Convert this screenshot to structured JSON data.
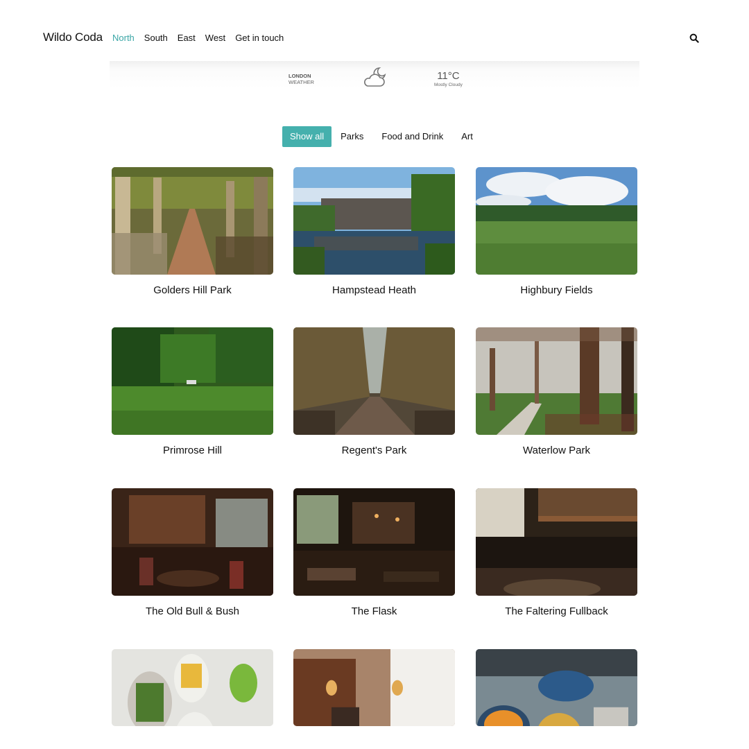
{
  "brand": "Wildo Coda",
  "nav": [
    "North",
    "South",
    "East",
    "West",
    "Get in touch"
  ],
  "nav_active": "North",
  "weather": {
    "city": "LONDON",
    "label": "WEATHER",
    "temp": "11°C",
    "condition": "Mostly Cloudy",
    "icon": "cloud-moon-icon"
  },
  "filters": [
    "Show all",
    "Parks",
    "Food and Drink",
    "Art"
  ],
  "filter_active": "Show all",
  "colors": {
    "accent": "#45b0ad",
    "nav_active": "#3aa6a6"
  },
  "places": [
    "Golders Hill Park",
    "Hampstead Heath",
    "Highbury Fields",
    "Primrose Hill",
    "Regent's Park",
    "Waterlow Park",
    "The Old Bull & Bush",
    "The Flask",
    "The Faltering Fullback"
  ]
}
